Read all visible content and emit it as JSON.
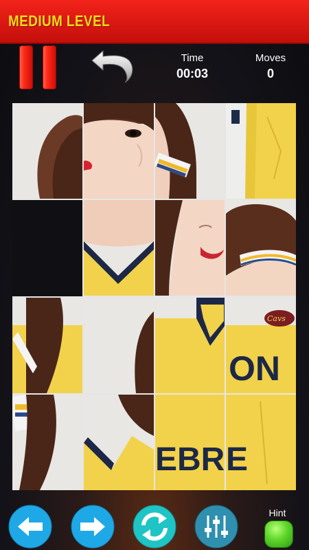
{
  "header": {
    "level_title": "MEDIUM LEVEL"
  },
  "toolbar": {
    "pause_icon": "pause-icon",
    "undo_icon": "undo-icon"
  },
  "stats": {
    "time_label": "Time",
    "time_value": "00:03",
    "moves_label": "Moves",
    "moves_value": "0"
  },
  "board": {
    "grid_size": "4x4",
    "empty_tile": "row 2, column 1"
  },
  "bottom_bar": {
    "left_icon": "arrow-left-icon",
    "right_icon": "arrow-right-icon",
    "shuffle_icon": "refresh-icon",
    "settings_icon": "sliders-icon",
    "hint_label": "Hint"
  },
  "colors": {
    "topbar": "#e31b12",
    "title": "#ffd91c",
    "button_blue": "#1fa8e6",
    "hint_green": "#5fd62a"
  }
}
